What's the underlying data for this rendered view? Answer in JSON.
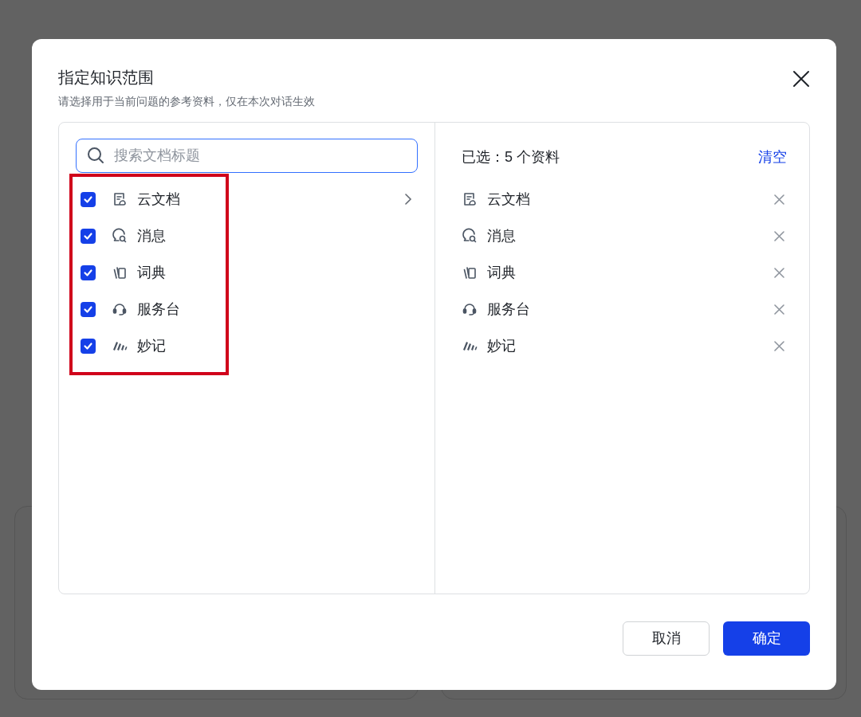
{
  "dialog": {
    "title": "指定知识范围",
    "subtitle": "请选择用于当前问题的参考资料，仅在本次对话生效"
  },
  "search": {
    "placeholder": "搜索文档标题"
  },
  "sources": [
    {
      "kind": "doc",
      "label": "云文档",
      "checked": true,
      "has_children": true
    },
    {
      "kind": "chat",
      "label": "消息",
      "checked": true,
      "has_children": false
    },
    {
      "kind": "dictionary",
      "label": "词典",
      "checked": true,
      "has_children": false
    },
    {
      "kind": "headset",
      "label": "服务台",
      "checked": true,
      "has_children": false
    },
    {
      "kind": "minutes",
      "label": "妙记",
      "checked": true,
      "has_children": false
    }
  ],
  "selected_panel": {
    "summary": "已选：5 个资料",
    "clear_link": "清空",
    "items": [
      {
        "kind": "doc",
        "label": "云文档"
      },
      {
        "kind": "chat",
        "label": "消息"
      },
      {
        "kind": "dictionary",
        "label": "词典"
      },
      {
        "kind": "headset",
        "label": "服务台"
      },
      {
        "kind": "minutes",
        "label": "妙记"
      }
    ]
  },
  "buttons": {
    "cancel": "取消",
    "confirm": "确定"
  }
}
